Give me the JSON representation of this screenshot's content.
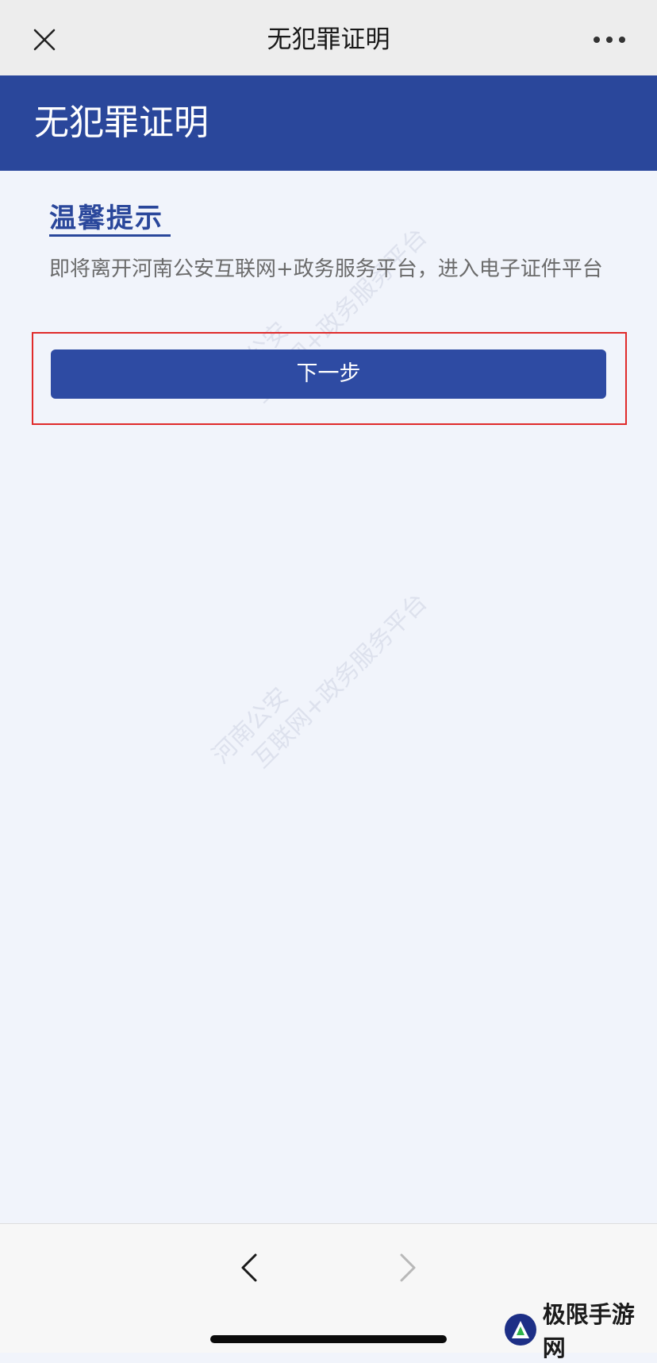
{
  "topbar": {
    "title": "无犯罪证明",
    "close_icon": "close-icon",
    "more_icon": "more-icon"
  },
  "header": {
    "title": "无犯罪证明"
  },
  "content": {
    "tip_title": "温馨提示",
    "tip_text": "即将离开河南公安互联网+政务服务平台，进入电子证件平台",
    "next_button_label": "下一步",
    "watermark_line1": "河南公安",
    "watermark_line2": "互联网+政务服务平台"
  },
  "bottombar": {
    "back_icon": "chevron-left-icon",
    "forward_icon": "chevron-right-icon",
    "brand_text": "极限手游网"
  },
  "colors": {
    "brand_blue": "#2a479b",
    "button_blue": "#2e4ba3",
    "highlight_red": "#e02a2a",
    "background": "#f1f4fb"
  }
}
